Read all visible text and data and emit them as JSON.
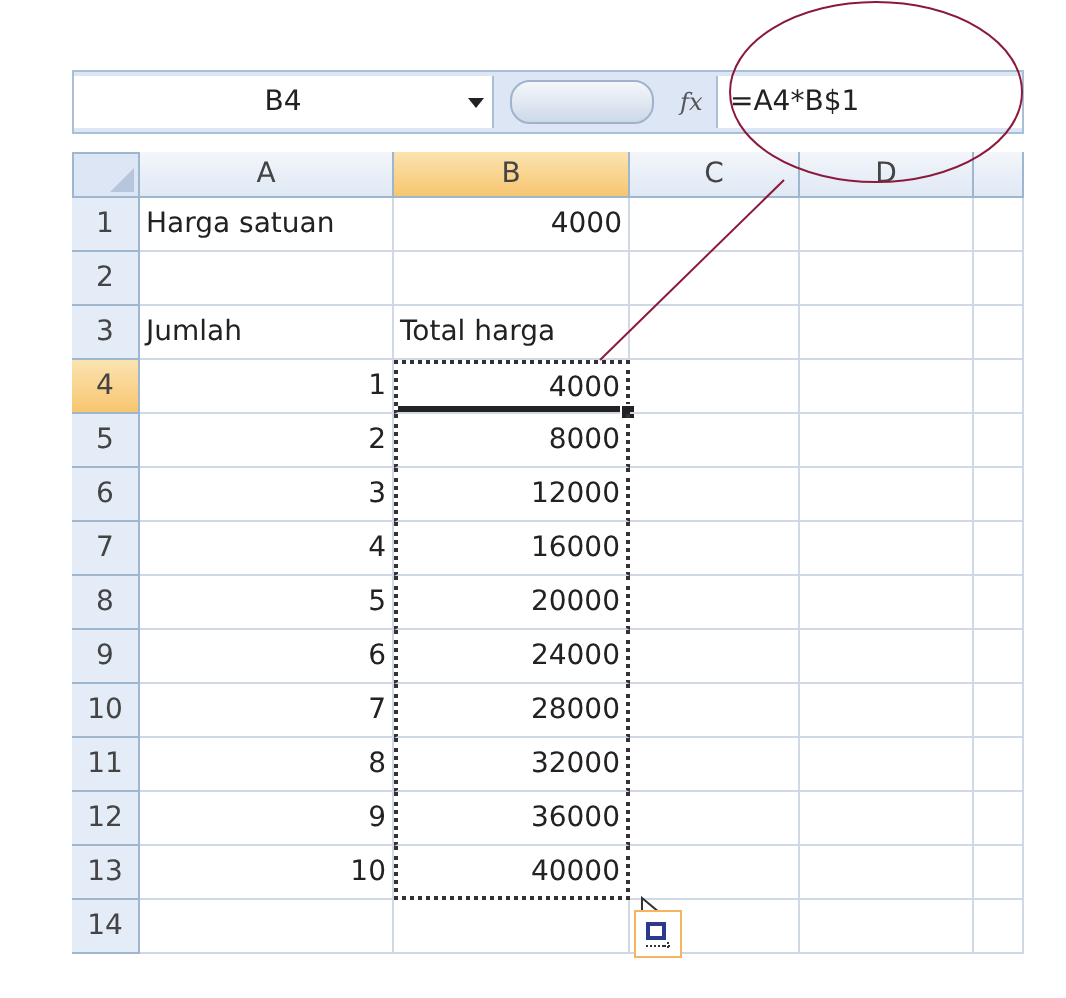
{
  "name_box": "B4",
  "function_label": "fx",
  "formula": "=A4*B$1",
  "columns": [
    {
      "label": "A",
      "selected": false
    },
    {
      "label": "B",
      "selected": true
    },
    {
      "label": "C",
      "selected": false
    },
    {
      "label": "D",
      "selected": false
    }
  ],
  "rows": [
    {
      "number": "1",
      "selected": false,
      "cells": [
        {
          "text": "Harga satuan",
          "kind": "text"
        },
        {
          "text": "4000",
          "kind": "number"
        }
      ]
    },
    {
      "number": "2",
      "selected": false,
      "cells": []
    },
    {
      "number": "3",
      "selected": false,
      "cells": [
        {
          "text": "Jumlah",
          "kind": "text"
        },
        {
          "text": "Total harga",
          "kind": "text"
        }
      ]
    },
    {
      "number": "4",
      "selected": true,
      "copied": true,
      "active": true,
      "cells": [
        {
          "text": "1",
          "kind": "number"
        },
        {
          "text": "4000",
          "kind": "number"
        }
      ]
    },
    {
      "number": "5",
      "selected": false,
      "copied": true,
      "active": false,
      "cells": [
        {
          "text": "2",
          "kind": "number"
        },
        {
          "text": "8000",
          "kind": "number"
        }
      ]
    },
    {
      "number": "6",
      "selected": false,
      "copied": true,
      "active": false,
      "cells": [
        {
          "text": "3",
          "kind": "number"
        },
        {
          "text": "12000",
          "kind": "number"
        }
      ]
    },
    {
      "number": "7",
      "selected": false,
      "copied": true,
      "active": false,
      "cells": [
        {
          "text": "4",
          "kind": "number"
        },
        {
          "text": "16000",
          "kind": "number"
        }
      ]
    },
    {
      "number": "8",
      "selected": false,
      "copied": true,
      "active": false,
      "cells": [
        {
          "text": "5",
          "kind": "number"
        },
        {
          "text": "20000",
          "kind": "number"
        }
      ]
    },
    {
      "number": "9",
      "selected": false,
      "copied": true,
      "active": false,
      "cells": [
        {
          "text": "6",
          "kind": "number"
        },
        {
          "text": "24000",
          "kind": "number"
        }
      ]
    },
    {
      "number": "10",
      "selected": false,
      "copied": true,
      "active": false,
      "cells": [
        {
          "text": "7",
          "kind": "number"
        },
        {
          "text": "28000",
          "kind": "number"
        }
      ]
    },
    {
      "number": "11",
      "selected": false,
      "copied": true,
      "active": false,
      "cells": [
        {
          "text": "8",
          "kind": "number"
        },
        {
          "text": "32000",
          "kind": "number"
        }
      ]
    },
    {
      "number": "12",
      "selected": false,
      "copied": true,
      "active": false,
      "cells": [
        {
          "text": "9",
          "kind": "number"
        },
        {
          "text": "36000",
          "kind": "number"
        }
      ]
    },
    {
      "number": "13",
      "selected": false,
      "copied": true,
      "active": false,
      "cells": [
        {
          "text": "10",
          "kind": "number"
        },
        {
          "text": "40000",
          "kind": "number"
        }
      ]
    },
    {
      "number": "14",
      "selected": false,
      "cells": []
    }
  ]
}
